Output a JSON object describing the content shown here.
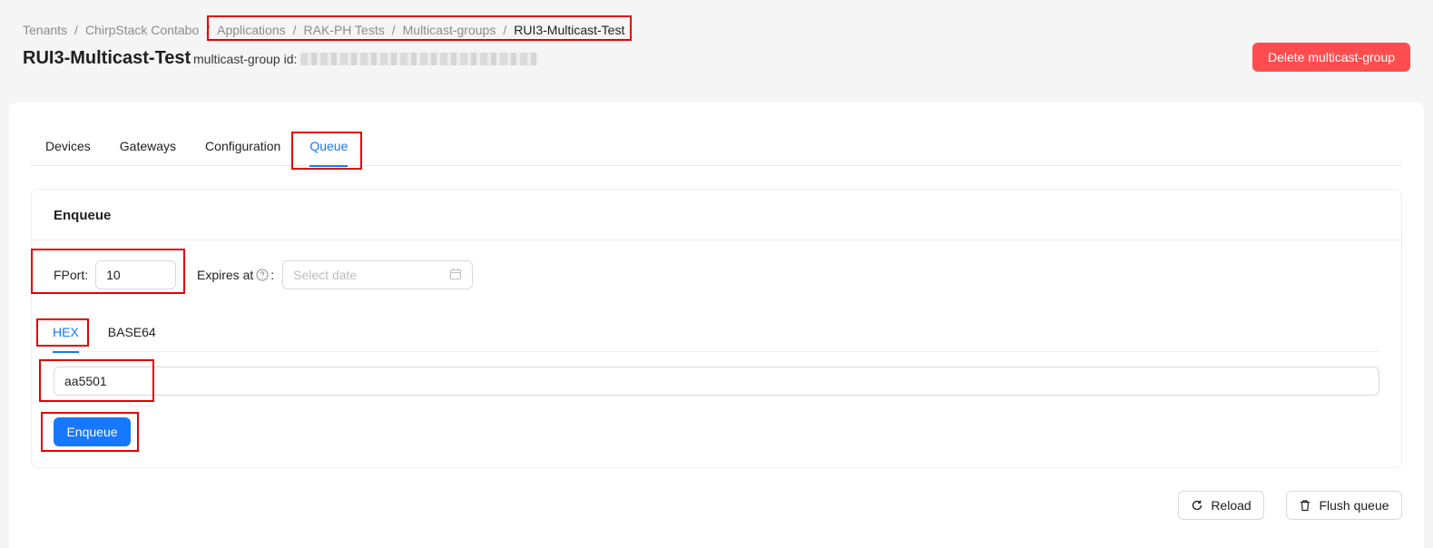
{
  "breadcrumb": {
    "items": [
      "Tenants",
      "ChirpStack Contabo",
      "Applications",
      "RAK-PH Tests",
      "Multicast-groups",
      "RUI3-Multicast-Test"
    ],
    "separator": "/"
  },
  "header": {
    "title": "RUI3-Multicast-Test",
    "id_label": "multicast-group id:",
    "delete_label": "Delete multicast-group"
  },
  "tabs": [
    {
      "label": "Devices",
      "active": false
    },
    {
      "label": "Gateways",
      "active": false
    },
    {
      "label": "Configuration",
      "active": false
    },
    {
      "label": "Queue",
      "active": true
    }
  ],
  "enqueue": {
    "title": "Enqueue",
    "fport_label": "FPort",
    "fport_value": "10",
    "expires_label": "Expires at",
    "date_placeholder": "Select date",
    "encoding_tabs": [
      "HEX",
      "BASE64"
    ],
    "active_encoding": "HEX",
    "payload_value": "aa5501",
    "submit_label": "Enqueue"
  },
  "actions": {
    "reload_label": "Reload",
    "flush_label": "Flush queue"
  },
  "colors": {
    "primary": "#1677ff",
    "danger": "#ff4d4f",
    "highlight": "#e60000"
  }
}
